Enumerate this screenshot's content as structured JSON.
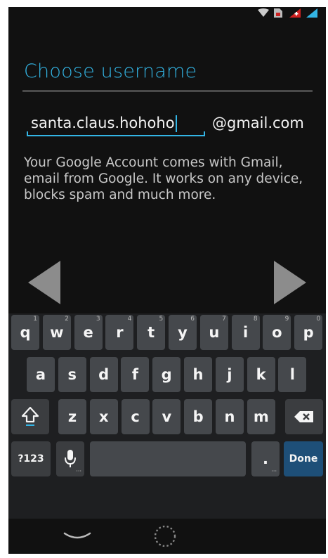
{
  "screen": {
    "title": "Choose username",
    "username": {
      "value": "santa.claus.hohoho",
      "domain_suffix": "@gmail.com"
    },
    "description": "Your Google Account comes with Gmail, email from Google. It works on any device, blocks spam and much more.",
    "accent_color": "#33b5e5"
  },
  "keyboard": {
    "row1": [
      {
        "label": "q",
        "hint": "1"
      },
      {
        "label": "w",
        "hint": "2"
      },
      {
        "label": "e",
        "hint": "3"
      },
      {
        "label": "r",
        "hint": "4"
      },
      {
        "label": "t",
        "hint": "5"
      },
      {
        "label": "y",
        "hint": "6"
      },
      {
        "label": "u",
        "hint": "7"
      },
      {
        "label": "i",
        "hint": "8"
      },
      {
        "label": "o",
        "hint": "9"
      },
      {
        "label": "p",
        "hint": "0"
      }
    ],
    "row2": [
      "a",
      "s",
      "d",
      "f",
      "g",
      "h",
      "j",
      "k",
      "l"
    ],
    "row3": [
      "z",
      "x",
      "c",
      "v",
      "b",
      "n",
      "m"
    ],
    "symbols_label": "?123",
    "period_label": ".",
    "done_label": "Done",
    "done_color": "#1e4f78",
    "icons": {
      "shift": "shift-icon",
      "backspace": "backspace-icon",
      "mic": "microphone-icon"
    }
  },
  "status_bar": {
    "icons": [
      "wifi-icon",
      "no-sim-icon",
      "battery-alert-icon",
      "signal-icon"
    ]
  },
  "nav_bar": {
    "icons": [
      "back-chevron-icon",
      "home-circle-icon"
    ]
  }
}
